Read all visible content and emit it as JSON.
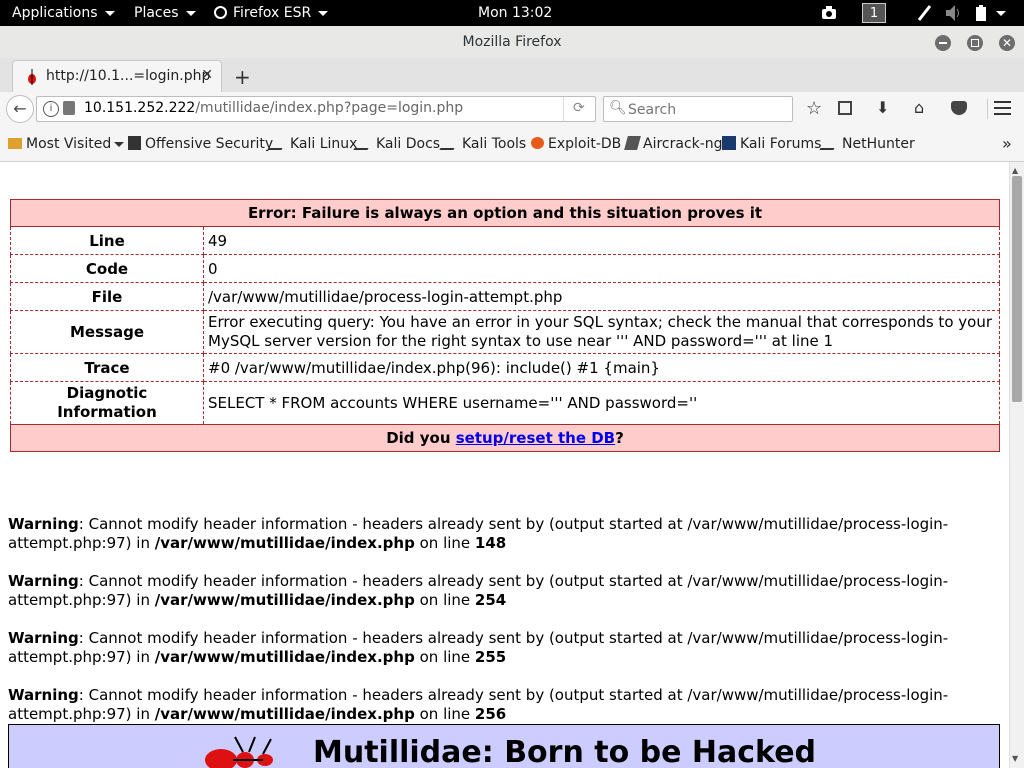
{
  "gnome_bar": {
    "applications": "Applications",
    "places": "Places",
    "firefox_menu": "Firefox ESR",
    "clock": "Mon 13:02",
    "workspace": "1"
  },
  "window": {
    "title": "Mozilla Firefox"
  },
  "tab": {
    "label": "http://10.1...=login.php"
  },
  "nav": {
    "url_host": "10.151.252.222",
    "url_path": "/mutillidae/index.php?page=login.php",
    "search_placeholder": "Search"
  },
  "bookmarks": [
    "Most Visited",
    "Offensive Security",
    "Kali Linux",
    "Kali Docs",
    "Kali Tools",
    "Exploit-DB",
    "Aircrack-ng",
    "Kali Forums",
    "NetHunter"
  ],
  "error": {
    "header": "Error: Failure is always an option and this situation proves it",
    "rows": [
      {
        "label": "Line",
        "value": "49"
      },
      {
        "label": "Code",
        "value": "0"
      },
      {
        "label": "File",
        "value": "/var/www/mutillidae/process-login-attempt.php"
      },
      {
        "label": "Message",
        "value": "Error executing query: You have an error in your SQL syntax; check the manual that corresponds to your MySQL server version for the right syntax to use near ''' AND password=''' at line 1"
      },
      {
        "label": "Trace",
        "value": "#0 /var/www/mutillidae/index.php(96): include() #1 {main}"
      },
      {
        "label": "Diagnotic Information",
        "value": "SELECT * FROM accounts WHERE username=''' AND password=''"
      }
    ],
    "footer_prefix": "Did you ",
    "footer_link": "setup/reset the DB",
    "footer_suffix": "?"
  },
  "warnings": [
    {
      "label": "Warning",
      "text": ": Cannot modify header information - headers already sent by (output started at /var/www/mutillidae/process-login-attempt.php:97) in ",
      "file": "/var/www/mutillidae/index.php",
      "online": " on line ",
      "line": "148"
    },
    {
      "label": "Warning",
      "text": ": Cannot modify header information - headers already sent by (output started at /var/www/mutillidae/process-login-attempt.php:97) in ",
      "file": "/var/www/mutillidae/index.php",
      "online": " on line ",
      "line": "254"
    },
    {
      "label": "Warning",
      "text": ": Cannot modify header information - headers already sent by (output started at /var/www/mutillidae/process-login-attempt.php:97) in ",
      "file": "/var/www/mutillidae/index.php",
      "online": " on line ",
      "line": "255"
    },
    {
      "label": "Warning",
      "text": ": Cannot modify header information - headers already sent by (output started at /var/www/mutillidae/process-login-attempt.php:97) in ",
      "file": "/var/www/mutillidae/index.php",
      "online": " on line ",
      "line": "256"
    }
  ],
  "banner": {
    "title": "Mutillidae: Born to be Hacked"
  },
  "colors": {
    "error_bg": "#ffcccc",
    "error_border": "#aa2a2a",
    "link": "#0000ee",
    "banner_bg": "#ccccff"
  }
}
